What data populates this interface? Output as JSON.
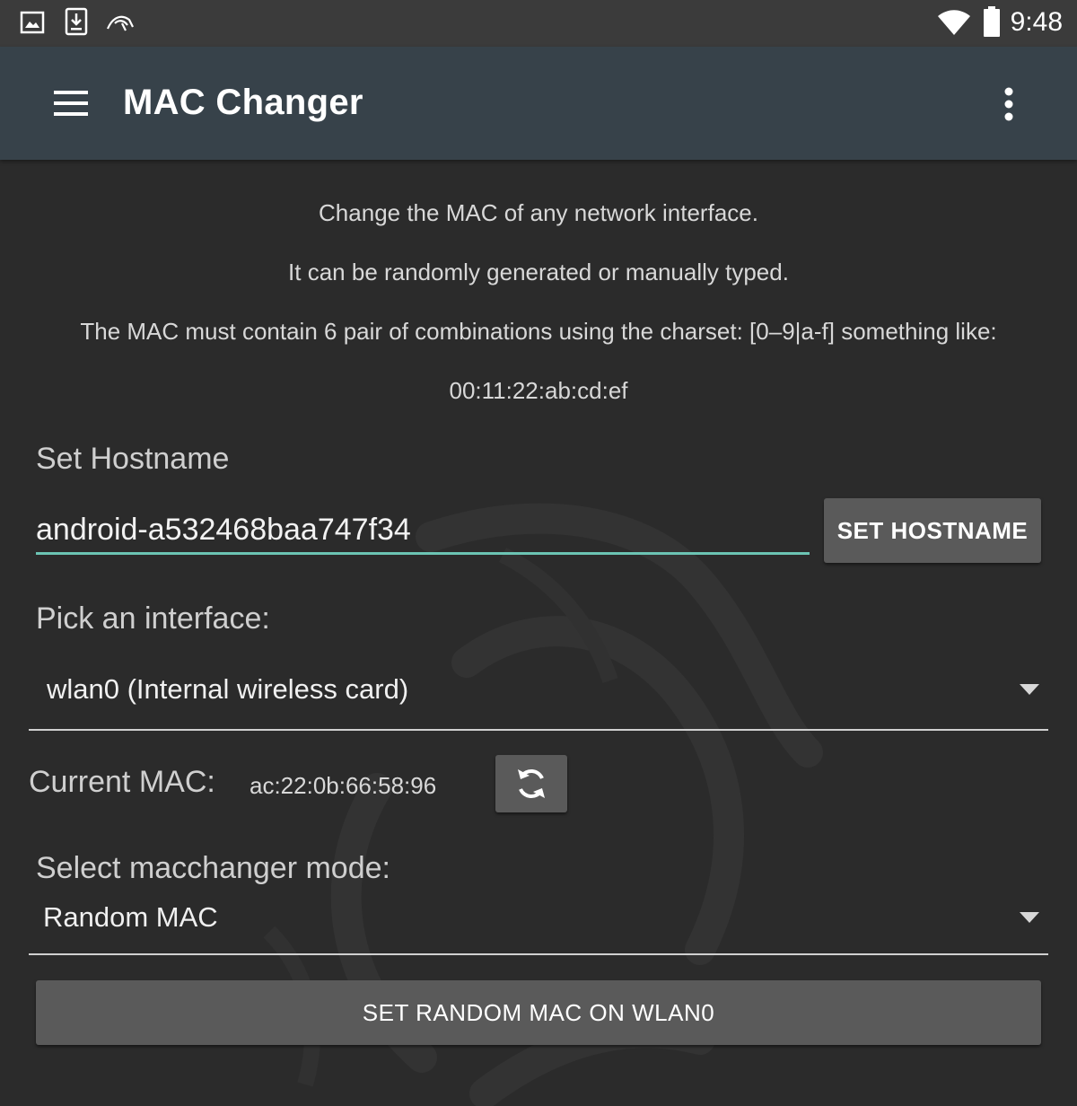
{
  "status_bar": {
    "time": "9:48",
    "icons": [
      "image-icon",
      "download-icon",
      "kali-dragon-icon",
      "wifi-icon",
      "battery-icon"
    ]
  },
  "app_bar": {
    "title": "MAC Changer",
    "menu_icon": "hamburger-menu-icon",
    "overflow_icon": "overflow-menu-icon"
  },
  "info": {
    "line1": "Change the MAC of any network interface.",
    "line2": "It can be randomly generated or manually typed.",
    "line3": "The MAC must contain 6 pair of combinations using the charset: [0–9|a-f] something like:",
    "example": "00:11:22:ab:cd:ef"
  },
  "hostname": {
    "label": "Set Hostname",
    "value": "android-a532468baa747f34",
    "button_label": "SET HOSTNAME"
  },
  "interface": {
    "label": "Pick an interface:",
    "selected": "wlan0 (Internal wireless card)"
  },
  "current_mac": {
    "label": "Current MAC:",
    "value": "ac:22:0b:66:58:96",
    "refresh_icon": "refresh-icon"
  },
  "mode": {
    "label": "Select macchanger mode:",
    "selected": "Random MAC"
  },
  "action": {
    "button_label": "SET RANDOM MAC ON WLAN0"
  },
  "colors": {
    "app_bar": "#37424a",
    "background": "#2b2b2b",
    "accent": "#6cc4b4",
    "button": "#5a5a5a"
  }
}
